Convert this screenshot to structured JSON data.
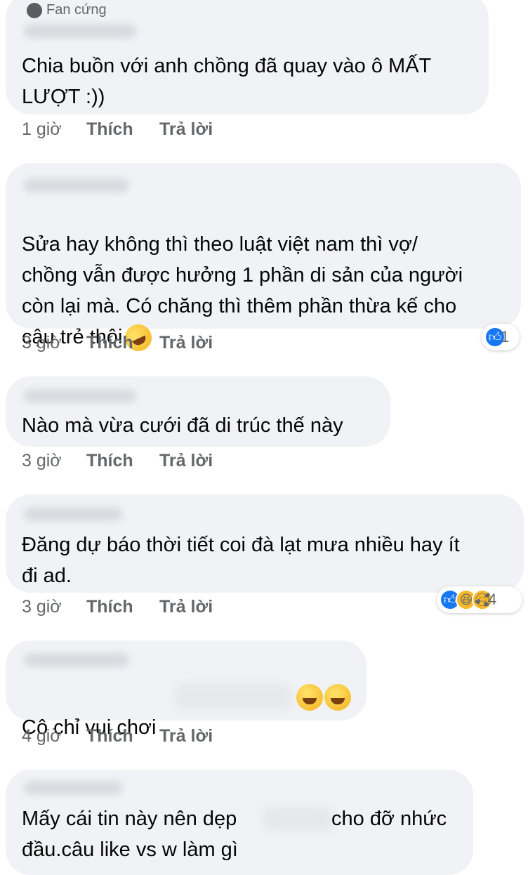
{
  "actions": {
    "like": "Thích",
    "reply": "Trả lời"
  },
  "comments": [
    {
      "badge": "Fan cứng",
      "text": "Chia buồn với anh chồng đã quay vào ô MẤT\nLƯỢT :))",
      "time": "1 giờ"
    },
    {
      "text": "Sửa hay không thì theo luật việt nam thì vợ/\nchồng vẫn được hưởng 1 phần di sản của người\ncòn lại mà. Có chăng thì thêm phần thừa kế cho\ncậu trẻ thôi",
      "emoji": "rolling-on-floor-laughing",
      "time": "3 giờ",
      "reactions": {
        "icons": [
          "like"
        ],
        "count": "1"
      }
    },
    {
      "text": "Nào mà vừa cưới đã di trúc thế này",
      "time": "3 giờ"
    },
    {
      "text": "Đăng dự báo thời tiết coi đà lạt mưa nhiều hay ít\nđi ad.",
      "time": "3 giờ",
      "reactions": {
        "icons": [
          "like",
          "haha",
          "care"
        ],
        "count": "4"
      }
    },
    {
      "text": "Cô chỉ vui chơi",
      "emoji": "face-with-tears-of-joy x2",
      "time": "4 giờ"
    },
    {
      "text_a": "Mấy cái tin này nên dẹp",
      "text_b": "cho đỡ nhức",
      "text_c": "đầu.câu like vs w làm gì"
    }
  ],
  "colors": {
    "bubble": "#f0f2f5",
    "meta_text": "#65676b",
    "like_blue": "#1877f2",
    "haha_yellow": "#f7b928"
  }
}
